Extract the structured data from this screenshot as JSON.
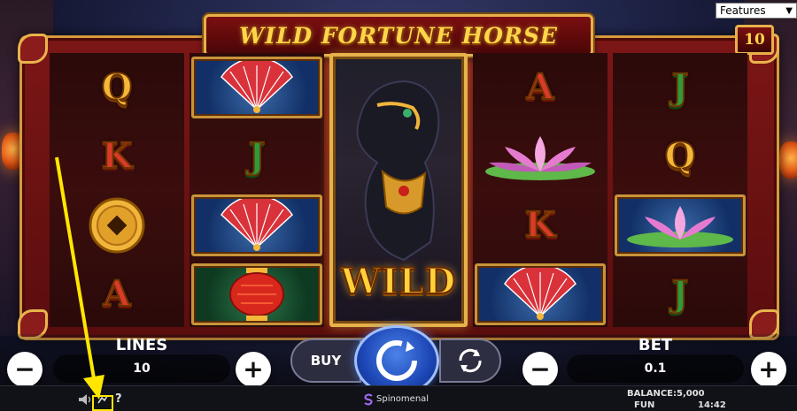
{
  "game": {
    "title": "Wild Fortune Horse",
    "title_display": "WILD FORTUNE HORSE",
    "paylines_badge": "10",
    "wild_label": "WILD"
  },
  "reels": [
    {
      "symbols": [
        "Q",
        "K",
        "coin",
        "A"
      ]
    },
    {
      "symbols": [
        "fan",
        "J",
        "fan",
        "lantern"
      ]
    },
    {
      "symbols": [
        "wild-horse",
        "wild-horse",
        "wild-horse",
        "wild-horse"
      ]
    },
    {
      "symbols": [
        "A",
        "lotus",
        "K",
        "fan"
      ]
    },
    {
      "symbols": [
        "J",
        "Q",
        "lotus",
        "J"
      ]
    }
  ],
  "controls": {
    "lines_label": "LINES",
    "lines_value": "10",
    "bet_label": "BET",
    "bet_value": "0.1",
    "buy_label": "BUY",
    "minus_symbol": "−",
    "plus_symbol": "+"
  },
  "footer": {
    "balance_label": "BALANCE:",
    "balance_value": "5,000",
    "mode": "FUN",
    "time": "14:42",
    "provider": "Spinomenal",
    "help": "?"
  },
  "features_select": {
    "selected": "Features"
  },
  "colors": {
    "gold": "#f4b73a",
    "frame_red": "#7c1616",
    "spin_blue": "#1d47b6",
    "annotation_yellow": "#ffe600"
  }
}
